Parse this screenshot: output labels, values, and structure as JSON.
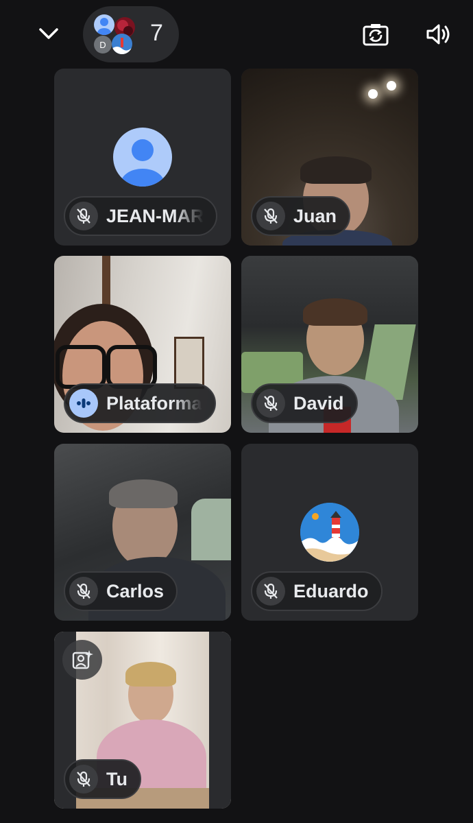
{
  "header": {
    "participant_count": "7",
    "mini_avatar_initial": "D",
    "icons": [
      "chevron-down-icon",
      "camera-flip-icon",
      "speaker-icon"
    ]
  },
  "tiles": [
    {
      "name": "JEAN-MARIE",
      "muted": true,
      "kind": "avatar"
    },
    {
      "name": "Juan",
      "muted": true,
      "kind": "video"
    },
    {
      "name": "Plataforma",
      "muted": false,
      "speaking": true,
      "kind": "video"
    },
    {
      "name": "David",
      "muted": true,
      "kind": "video"
    },
    {
      "name": "Carlos",
      "muted": true,
      "kind": "video"
    },
    {
      "name": "Eduardo",
      "muted": true,
      "kind": "avatar"
    },
    {
      "name": "Tu",
      "muted": true,
      "kind": "video",
      "self": true
    }
  ],
  "colors": {
    "background": "#121214",
    "tile": "#2a2b2e",
    "chip": "#1e1f22",
    "speaking_accent": "#a8c7fa",
    "default_avatar": "#aecbfa",
    "default_avatar_figure": "#4285f4"
  }
}
